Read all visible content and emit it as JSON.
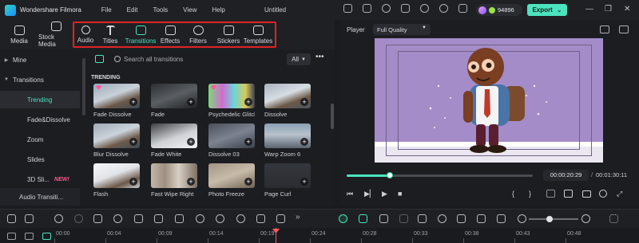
{
  "app": {
    "name": "Wondershare Filmora",
    "document_title": "Untitled",
    "menu": [
      "File",
      "Edit",
      "Tools",
      "View",
      "Help"
    ],
    "credits": "94896",
    "export_label": "Export",
    "export_chevron": "⌄",
    "window_controls": [
      "—",
      "❐",
      "✕"
    ]
  },
  "toolbar": {
    "tools": [
      {
        "label": "Media",
        "icon": "media-icon"
      },
      {
        "label": "Stock Media",
        "icon": "stock-media-icon"
      },
      {
        "label": "Audio",
        "icon": "music-note-icon"
      },
      {
        "label": "Titles",
        "icon": "text-t-icon"
      },
      {
        "label": "Transitions",
        "icon": "transitions-icon"
      },
      {
        "label": "Effects",
        "icon": "effects-sparkle-icon"
      },
      {
        "label": "Filters",
        "icon": "filters-circle-icon"
      },
      {
        "label": "Stickers",
        "icon": "stickers-icon"
      },
      {
        "label": "Templates",
        "icon": "templates-icon"
      }
    ],
    "active": "Transitions"
  },
  "sidebar": {
    "items": [
      {
        "label": "Mine",
        "arrow": "▶"
      },
      {
        "label": "Transitions",
        "arrow": "▼"
      },
      {
        "label": "Trending",
        "arrow": ""
      },
      {
        "label": "Fade&Dissolve",
        "arrow": ""
      },
      {
        "label": "Zoom",
        "arrow": ""
      },
      {
        "label": "Slides",
        "arrow": ""
      },
      {
        "label": "3D Sli...",
        "arrow": "",
        "badge": "NEW!"
      },
      {
        "label": "Audio Transiti...",
        "arrow": ""
      }
    ]
  },
  "content": {
    "search_placeholder": "Search all transitions",
    "filter_select": "All",
    "more": "•••",
    "section_title": "TRENDING",
    "items": [
      {
        "name": "Fade Dissolve"
      },
      {
        "name": "Fade"
      },
      {
        "name": "Psychedelic Glitch"
      },
      {
        "name": "Dissolve"
      },
      {
        "name": "Blur Dissolve"
      },
      {
        "name": "Fade White"
      },
      {
        "name": "Dissolve 03"
      },
      {
        "name": "Warp Zoom 6"
      },
      {
        "name": "Flash"
      },
      {
        "name": "Fast Wipe Right"
      },
      {
        "name": "Photo Freeze"
      },
      {
        "name": "Page Curl"
      }
    ]
  },
  "player": {
    "label": "Player",
    "quality": "Full Quality",
    "current_time": "00:00:20:29",
    "separator": "/",
    "total_time": "00:01:30:11",
    "progress": 0.23,
    "controls": [
      "⏮",
      "▶▏",
      "▶",
      "■",
      "{",
      "}",
      "⤢"
    ]
  },
  "timeline": {
    "ticks": [
      "00:00",
      "00:04",
      "00:09",
      "00:14",
      "00:19",
      "00:24",
      "00:28",
      "00:33",
      "00:38",
      "00:43",
      "00:48"
    ],
    "playhead_time": "00:19",
    "zoom": 0.42
  },
  "colors": {
    "accent": "#4be4c0",
    "highlight_box": "#e02424",
    "stage_background": "#a48cc8",
    "playhead": "#ff5a5a"
  }
}
